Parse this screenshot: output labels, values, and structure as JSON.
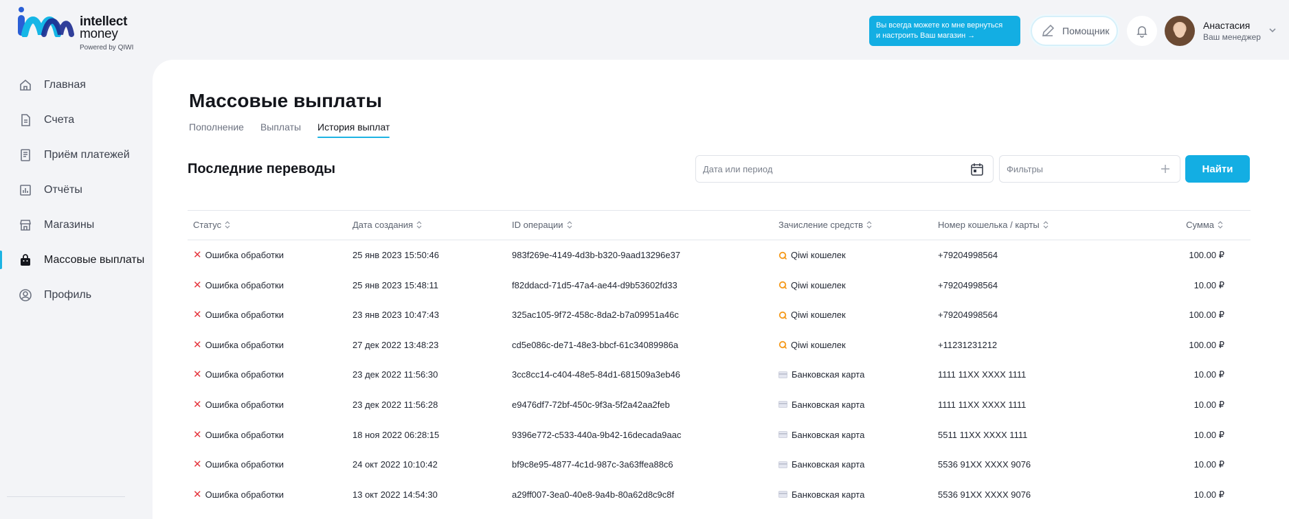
{
  "brand": {
    "name_line1": "intellect",
    "name_line2": "money",
    "powered": "Powered by QIWI",
    "colors": {
      "blue": "#2a5fd6",
      "cyan": "#15b6e6",
      "navy": "#1c2b8f"
    }
  },
  "sidebar": {
    "items": [
      {
        "label": "Главная",
        "icon": "home-icon"
      },
      {
        "label": "Счета",
        "icon": "document-icon"
      },
      {
        "label": "Приём платежей",
        "icon": "receipt-icon"
      },
      {
        "label": "Отчёты",
        "icon": "chart-icon"
      },
      {
        "label": "Магазины",
        "icon": "store-icon"
      },
      {
        "label": "Массовые выплаты",
        "icon": "bag-icon",
        "active": true
      },
      {
        "label": "Профиль",
        "icon": "profile-icon"
      }
    ]
  },
  "header": {
    "promo_line1": "Вы всегда можете ко мне вернуться",
    "promo_line2": "и настроить Ваш магазин →",
    "helper_label": "Помощник",
    "manager_name": "Анастасия",
    "manager_role": "Ваш менеджер"
  },
  "page": {
    "title": "Массовые выплаты",
    "tabs": [
      {
        "label": "Пополнение"
      },
      {
        "label": "Выплаты"
      },
      {
        "label": "История выплат",
        "active": true
      }
    ],
    "section_title": "Последние переводы",
    "date_placeholder": "Дата или период",
    "filter_placeholder": "Фильтры",
    "find_label": "Найти"
  },
  "table": {
    "columns": [
      "Статус",
      "Дата создания",
      "ID операции",
      "Зачисление средств",
      "Номер кошелька / карты",
      "Сумма"
    ],
    "rows": [
      {
        "status": "Ошибка обработки",
        "date": "25 янв 2023 15:50:46",
        "id": "983f269e-4149-4d3b-b320-9aad13296e37",
        "method": "Qiwi кошелек",
        "method_type": "qiwi",
        "number": "+79204998564",
        "amount": "100.00 ₽"
      },
      {
        "status": "Ошибка обработки",
        "date": "25 янв 2023 15:48:11",
        "id": "f82ddacd-71d5-47a4-ae44-d9b53602fd33",
        "method": "Qiwi кошелек",
        "method_type": "qiwi",
        "number": "+79204998564",
        "amount": "10.00 ₽"
      },
      {
        "status": "Ошибка обработки",
        "date": "23 янв 2023 10:47:43",
        "id": "325ac105-9f72-458c-8da2-b7a09951a46c",
        "method": "Qiwi кошелек",
        "method_type": "qiwi",
        "number": "+79204998564",
        "amount": "100.00 ₽"
      },
      {
        "status": "Ошибка обработки",
        "date": "27 дек 2022 13:48:23",
        "id": "cd5e086c-de71-48e3-bbcf-61c34089986a",
        "method": "Qiwi кошелек",
        "method_type": "qiwi",
        "number": "+11231231212",
        "amount": "100.00 ₽"
      },
      {
        "status": "Ошибка обработки",
        "date": "23 дек 2022 11:56:30",
        "id": "3cc8cc14-c404-48e5-84d1-681509a3eb46",
        "method": "Банковская карта",
        "method_type": "card",
        "number": "1111 11XX XXXX 1111",
        "amount": "10.00 ₽"
      },
      {
        "status": "Ошибка обработки",
        "date": "23 дек 2022 11:56:28",
        "id": "e9476df7-72bf-450c-9f3a-5f2a42aa2feb",
        "method": "Банковская карта",
        "method_type": "card",
        "number": "1111 11XX XXXX 1111",
        "amount": "10.00 ₽"
      },
      {
        "status": "Ошибка обработки",
        "date": "18 ноя 2022 06:28:15",
        "id": "9396e772-c533-440a-9b42-16decada9aac",
        "method": "Банковская карта",
        "method_type": "card",
        "number": "5511 11XX XXXX 1111",
        "amount": "10.00 ₽"
      },
      {
        "status": "Ошибка обработки",
        "date": "24 окт 2022 10:10:42",
        "id": "bf9c8e95-4877-4c1d-987c-3a63ffea88c6",
        "method": "Банковская карта",
        "method_type": "card",
        "number": "5536 91XX XXXX 9076",
        "amount": "10.00 ₽"
      },
      {
        "status": "Ошибка обработки",
        "date": "13 окт 2022 14:54:30",
        "id": "a29ff007-3ea0-40e8-9a4b-80a62d8c9c8f",
        "method": "Банковская карта",
        "method_type": "card",
        "number": "5536 91XX XXXX 9076",
        "amount": "10.00 ₽"
      }
    ]
  }
}
